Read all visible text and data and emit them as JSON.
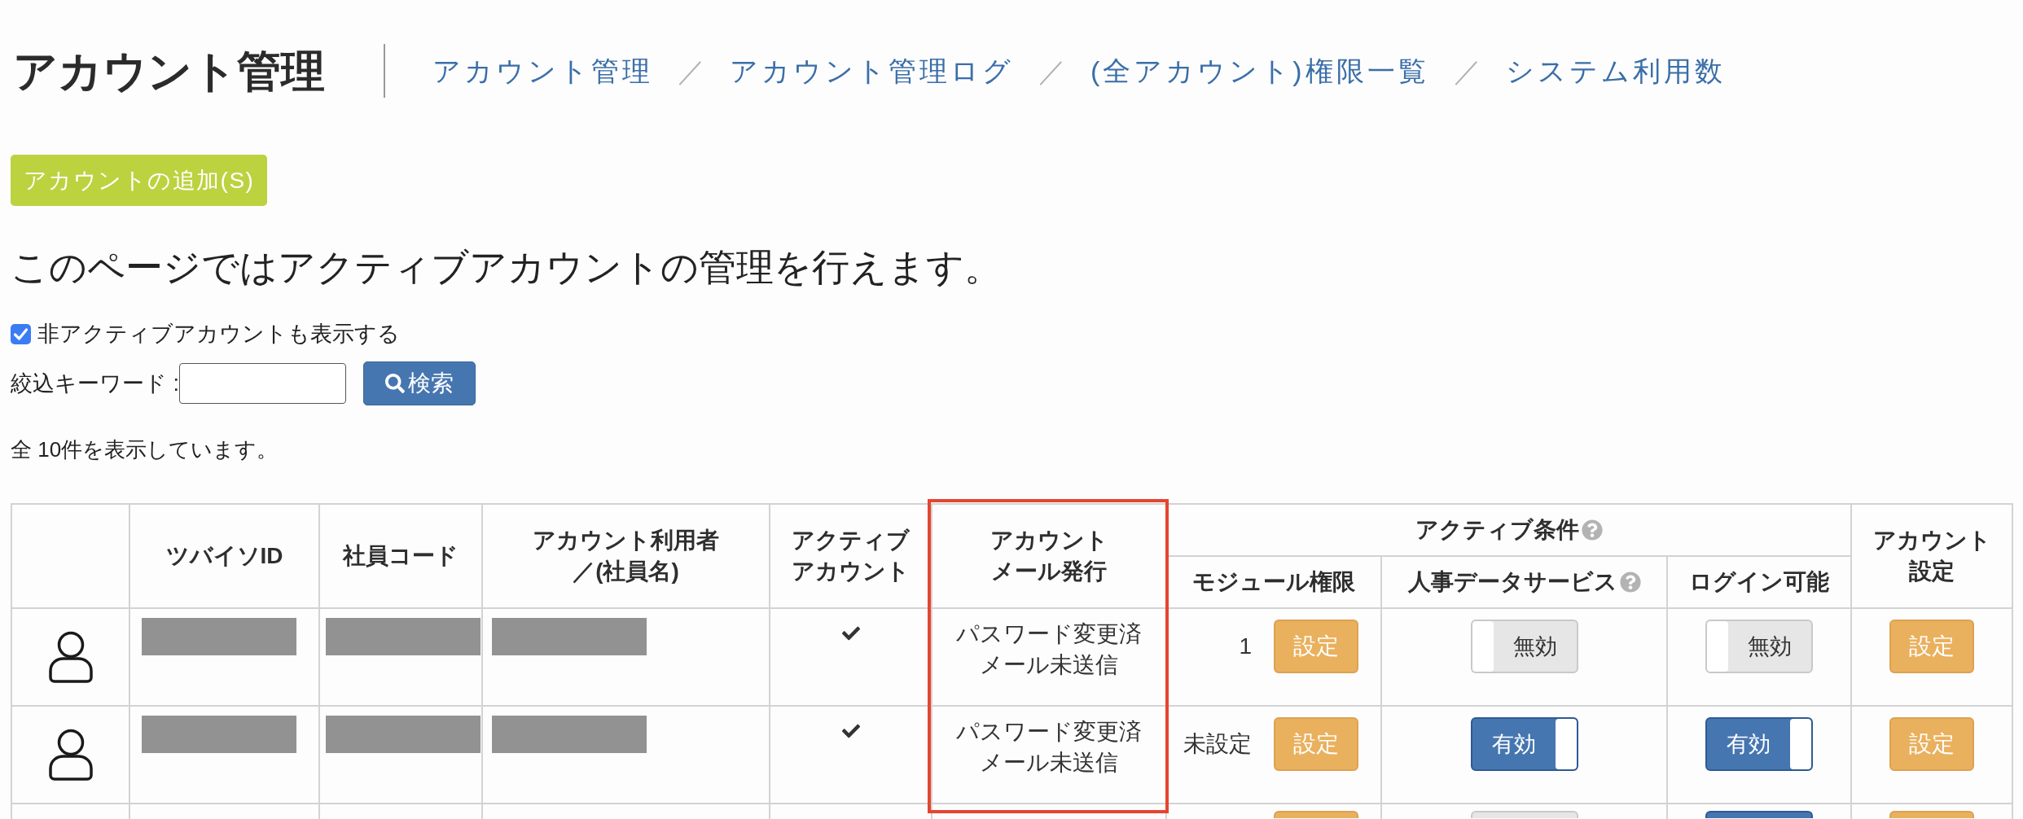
{
  "page_header": {
    "title": "アカウント管理",
    "nav": [
      {
        "kind": "link",
        "label": "アカウント管理"
      },
      {
        "kind": "separator",
        "label": "／"
      },
      {
        "kind": "link",
        "label": "アカウント管理ログ"
      },
      {
        "kind": "separator",
        "label": "／"
      },
      {
        "kind": "link",
        "label": "(全アカウント)権限一覧"
      },
      {
        "kind": "separator",
        "label": "／"
      },
      {
        "kind": "link",
        "label": "システム利用数"
      }
    ]
  },
  "add_button": {
    "label": "アカウントの追加(S)"
  },
  "description": "このページではアクティブアカウントの管理を行えます。",
  "show_inactive": {
    "label": "非アクティブアカウントも表示する",
    "checked": true
  },
  "keyword_filter": {
    "label": "絞込キーワード :",
    "button": "検索"
  },
  "result_count": "全 10件を表示しています。",
  "table": {
    "columns": [
      {
        "kind": "blank"
      },
      {
        "kind": "single",
        "lines": [
          "ツバイソID"
        ],
        "highlighted": false
      },
      {
        "kind": "single",
        "lines": [
          "社員コード"
        ],
        "highlighted": false
      },
      {
        "kind": "single",
        "lines": [
          "アカウント利用者",
          "／(社員名)"
        ],
        "highlighted": false
      },
      {
        "kind": "single",
        "lines": [
          "アクティブ",
          "アカウント"
        ],
        "highlighted": false
      },
      {
        "kind": "single",
        "lines": [
          "アカウント",
          "メール発行"
        ],
        "highlighted": true
      },
      {
        "kind": "group",
        "label": "アクティブ条件",
        "help": true,
        "highlighted": false,
        "children": [
          {
            "lines": [
              "モジュール権限"
            ],
            "help": false
          },
          {
            "lines": [
              "人事データサービス"
            ],
            "help": true
          },
          {
            "lines": [
              "ログイン可能"
            ],
            "help": false
          }
        ]
      },
      {
        "kind": "single",
        "lines": [
          "アカウント",
          "設定"
        ],
        "highlighted": false
      }
    ],
    "rows": [
      {
        "user_icon": true,
        "tsubaiso_id": {
          "redacted": true
        },
        "employee_code": {
          "redacted": true
        },
        "user_name": {
          "redacted": true
        },
        "active": true,
        "mail_status": [
          "パスワード変更済",
          "メール未送信"
        ],
        "module_permission": {
          "count": "1",
          "button": "設定"
        },
        "hr_data_service": {
          "label": "無効",
          "on": false
        },
        "login": {
          "label": "無効",
          "on": false
        },
        "settings_button": "設定"
      },
      {
        "user_icon": true,
        "tsubaiso_id": {
          "redacted": true
        },
        "employee_code": {
          "redacted": true
        },
        "user_name": {
          "redacted": true
        },
        "active": true,
        "mail_status": [
          "パスワード変更済",
          "メール未送信"
        ],
        "module_permission": {
          "count": "未設定",
          "button": "設定"
        },
        "hr_data_service": {
          "label": "有効",
          "on": true
        },
        "login": {
          "label": "有効",
          "on": true
        },
        "settings_button": "設定"
      }
    ],
    "cut_off_row": {
      "hr_data_service": {
        "on": false
      },
      "login": {
        "on": true
      }
    }
  }
}
